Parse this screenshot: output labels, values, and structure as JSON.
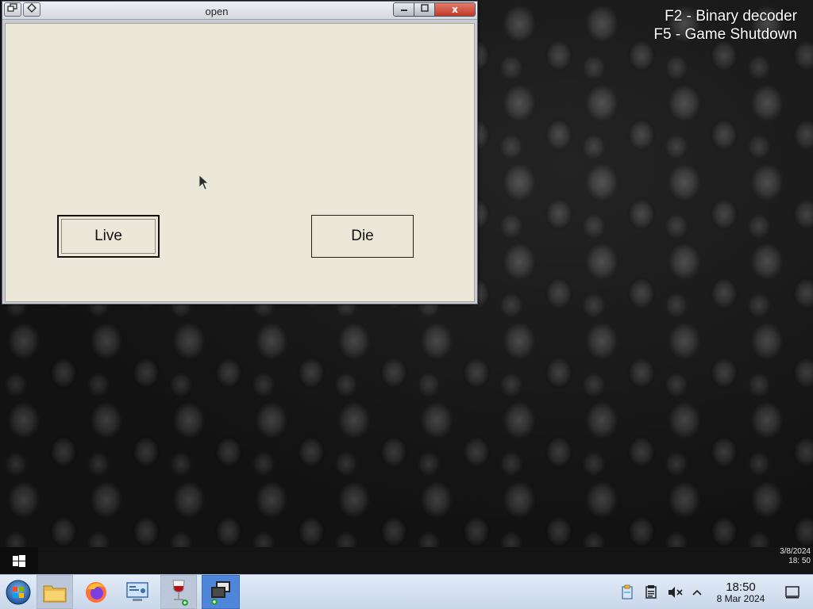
{
  "desktop": {
    "hotkeys": [
      "F2 - Binary decoder",
      "F5 - Game Shutdown"
    ]
  },
  "window": {
    "title": "open",
    "buttons": {
      "live_label": "Live",
      "die_label": "Die"
    },
    "wm": {
      "minimize": "▁",
      "maximize": "▢",
      "close": "x"
    }
  },
  "infobar": {
    "date": "3/8/2024",
    "time": "18: 50"
  },
  "taskbar": {
    "icons": [
      "start-orb-icon",
      "file-manager-icon",
      "firefox-icon",
      "control-panel-icon",
      "wine-glass-icon",
      "window-switcher-icon"
    ],
    "clock": {
      "time": "18:50",
      "date": "8 Mar 2024"
    },
    "tray": [
      "clipboard-icon",
      "notes-icon",
      "volume-muted-icon",
      "chevron-up-icon",
      "show-desktop-icon"
    ]
  },
  "colors": {
    "window_bg": "#ebe8d9",
    "taskbar_bg": "#dce6f3",
    "close_red": "#c23a28",
    "active_highlight": "#4f86d9"
  }
}
